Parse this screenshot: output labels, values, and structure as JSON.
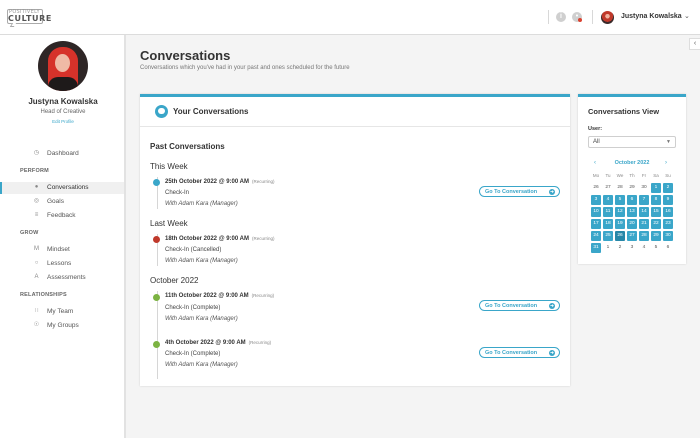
{
  "brand": {
    "line1": "POSITIVELY",
    "line2": "CULTURE"
  },
  "topbar": {
    "user_name": "Justyna Kowalska",
    "icons": [
      "info-icon",
      "bell-icon"
    ]
  },
  "profile": {
    "name": "Justyna Kowalska",
    "role": "Head of Creative",
    "edit_label": "Edit Profile"
  },
  "nav": {
    "dashboard": "Dashboard",
    "sections": {
      "perform": "PERFORM",
      "grow": "GROW",
      "relationships": "RELATIONSHIPS"
    },
    "perform_items": [
      {
        "label": "Conversations",
        "icon": "chat-icon",
        "active": true
      },
      {
        "label": "Goals",
        "icon": "target-icon"
      },
      {
        "label": "Feedback",
        "icon": "list-icon"
      }
    ],
    "grow_items": [
      {
        "label": "Mindset",
        "icon": "mindset-icon"
      },
      {
        "label": "Lessons",
        "icon": "lessons-icon"
      },
      {
        "label": "Assessments",
        "icon": "assessments-icon"
      }
    ],
    "relationships_items": [
      {
        "label": "My Team",
        "icon": "team-icon"
      },
      {
        "label": "My Groups",
        "icon": "groups-icon"
      }
    ]
  },
  "page": {
    "title": "Conversations",
    "subtitle": "Conversations which you've had in your past and ones scheduled for the future"
  },
  "conversations": {
    "card_title": "Your Conversations",
    "past_heading": "Past Conversations",
    "go_label": "Go To Conversation",
    "recurring_label": "(Recurring)",
    "groups": [
      {
        "title": "This Week",
        "items": [
          {
            "date": "25th October 2022 @ 9:00 AM",
            "type": "Check-In",
            "with": "With Adam Kara (Manager)",
            "status_color": "#3aa6c9",
            "has_button": true
          }
        ]
      },
      {
        "title": "Last Week",
        "items": [
          {
            "date": "18th October 2022 @ 9:00 AM",
            "type": "Check-In (Cancelled)",
            "with": "With Adam Kara (Manager)",
            "status_color": "#c0392b",
            "has_button": false
          }
        ]
      },
      {
        "title": "October 2022",
        "items": [
          {
            "date": "11th October 2022 @ 9:00 AM",
            "type": "Check-In (Complete)",
            "with": "With Adam Kara (Manager)",
            "status_color": "#7cb342",
            "has_button": true
          },
          {
            "date": "4th October 2022 @ 9:00 AM",
            "type": "Check-In (Complete)",
            "with": "With Adam Kara (Manager)",
            "status_color": "#7cb342",
            "has_button": true
          }
        ]
      }
    ]
  },
  "view_panel": {
    "title": "Conversations View",
    "user_label": "User:",
    "user_value": "All",
    "calendar": {
      "month": "October 2022",
      "dow": [
        "Mo",
        "Tu",
        "We",
        "Th",
        "Fr",
        "Sa",
        "Su"
      ],
      "days": [
        "26",
        "27",
        "28",
        "29",
        "30",
        "1",
        "2",
        "3",
        "4",
        "5",
        "6",
        "7",
        "8",
        "9",
        "10",
        "11",
        "12",
        "13",
        "14",
        "15",
        "16",
        "17",
        "18",
        "19",
        "20",
        "21",
        "22",
        "23",
        "24",
        "25",
        "26",
        "27",
        "28",
        "29",
        "30",
        "31",
        "1",
        "2",
        "3",
        "4",
        "5",
        "6"
      ],
      "highlighted": [
        5,
        6,
        7,
        8,
        9,
        10,
        11,
        12,
        13,
        14,
        15,
        16,
        17,
        18,
        19,
        20,
        21,
        22,
        23,
        24,
        25,
        26,
        27,
        28,
        29,
        30,
        31,
        32,
        33,
        34,
        35
      ],
      "today_index": 30
    }
  }
}
